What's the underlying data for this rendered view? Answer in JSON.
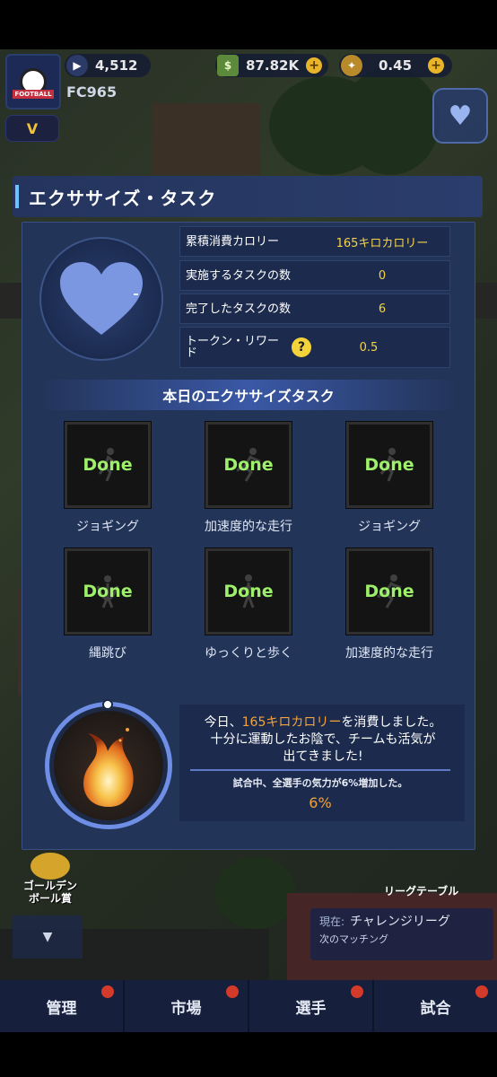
{
  "hud": {
    "team_name": "FC965",
    "trophies": "4,512",
    "cash": "87.82K",
    "tokens": "0.45",
    "v_badge": "V"
  },
  "modal": {
    "title": "エクササイズ・タスク",
    "stats": [
      {
        "label": "累積消費カロリー",
        "value": "165キロカロリー"
      },
      {
        "label": "実施するタスクの数",
        "value": "0"
      },
      {
        "label": "完了したタスクの数",
        "value": "6"
      },
      {
        "label": "トークン・リワード",
        "value": "0.5",
        "help": "?"
      }
    ],
    "section_title": "本日のエクササイズタスク",
    "tasks": [
      {
        "status": "Done",
        "label": "ジョギング"
      },
      {
        "status": "Done",
        "label": "加速度的な走行"
      },
      {
        "status": "Done",
        "label": "ジョギング"
      },
      {
        "status": "Done",
        "label": "縄跳び"
      },
      {
        "status": "Done",
        "label": "ゆっくりと歩く"
      },
      {
        "status": "Done",
        "label": "加速度的な走行"
      }
    ],
    "summary": {
      "line1_pre": "今日、",
      "line1_highlight": "165キロカロリー",
      "line1_post": "を消費しました。",
      "line2": "十分に運動したお陰で、チームも活気が",
      "line3": "出てきました!",
      "boost_text": "試合中、全選手の気力が6%増加した。",
      "boost_percent": "6%"
    }
  },
  "side": {
    "golden_ball": "ゴールデン\nボール賞",
    "collapse": "▼"
  },
  "league": {
    "table_label": "リーグテーブル",
    "current_label": "現在:",
    "current_value": "チャレンジリーグ",
    "next_match": "次のマッチング"
  },
  "nav": [
    "管理",
    "市場",
    "選手",
    "試合"
  ],
  "colors": {
    "done_green": "#9ef06a",
    "value_yellow": "#f4d34a",
    "highlight_orange": "#f2a23a",
    "panel_bg": "#233459"
  }
}
